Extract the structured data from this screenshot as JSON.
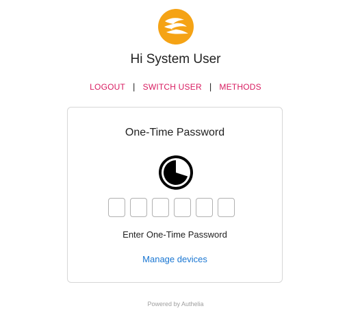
{
  "greeting": "Hi System User",
  "nav": {
    "logout": "LOGOUT",
    "separator": "|",
    "switch_user": "SWITCH USER",
    "methods": "METHODS"
  },
  "card": {
    "title": "One-Time Password",
    "timer_icon": "countdown-timer-icon",
    "timer_progress": 0.3,
    "otp_digits": [
      "",
      "",
      "",
      "",
      "",
      ""
    ],
    "input_label": "Enter One-Time Password",
    "manage_link": "Manage devices"
  },
  "footer": {
    "powered_by": "Powered by Authelia"
  },
  "colors": {
    "logo": "#f5a315",
    "accent": "#d81b60",
    "link": "#1976d2",
    "text": "#212121",
    "muted": "#9e9e9e"
  }
}
